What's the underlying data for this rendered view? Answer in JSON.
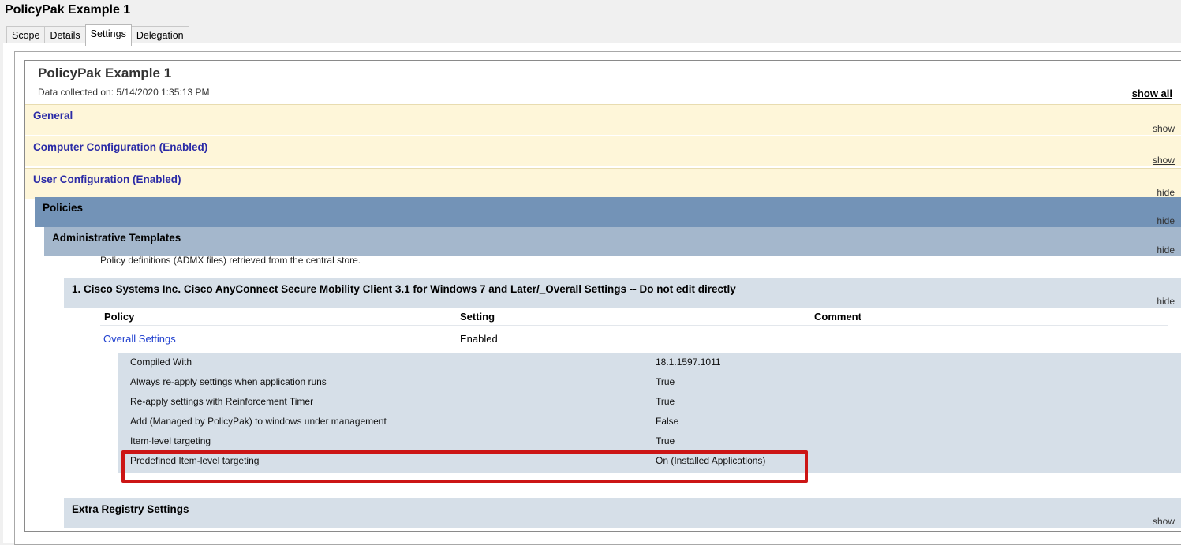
{
  "window": {
    "title": "PolicyPak Example 1"
  },
  "tabs": [
    {
      "label": "Scope"
    },
    {
      "label": "Details"
    },
    {
      "label": "Settings"
    },
    {
      "label": "Delegation"
    }
  ],
  "report": {
    "title": "PolicyPak Example 1",
    "collected": "Data collected on: 5/14/2020 1:35:13 PM",
    "show_all": "show all",
    "sections": {
      "general": {
        "label": "General",
        "action": "show"
      },
      "computer": {
        "label": "Computer Configuration (Enabled)",
        "action": "show"
      },
      "user": {
        "label": "User Configuration (Enabled)",
        "action": "hide"
      },
      "policies": {
        "label": "Policies",
        "action": "hide"
      },
      "admin": {
        "label": "Administrative Templates",
        "action": "hide"
      },
      "central_store": "Policy definitions (ADMX files) retrieved from the central store.",
      "cisco": {
        "label": "1. Cisco Systems Inc. Cisco AnyConnect Secure Mobility Client 3.1 for Windows 7 and Later/_Overall Settings -- Do not edit directly",
        "action": "hide"
      },
      "extra": {
        "label": "Extra Registry Settings",
        "action": "show"
      }
    },
    "policy_table": {
      "headers": [
        "Policy",
        "Setting",
        "Comment"
      ],
      "row": {
        "policy": "Overall Settings",
        "setting": "Enabled",
        "comment": ""
      }
    },
    "details": [
      {
        "key": "Compiled With",
        "value": "18.1.1597.1011"
      },
      {
        "key": "Always re-apply settings when application runs",
        "value": "True"
      },
      {
        "key": "Re-apply settings with Reinforcement Timer",
        "value": "True"
      },
      {
        "key": "Add (Managed by PolicyPak) to windows under management",
        "value": "False"
      },
      {
        "key": "Item-level targeting",
        "value": "True"
      },
      {
        "key": "Predefined Item-level targeting",
        "value": "On (Installed Applications)"
      }
    ]
  },
  "colors": {
    "highlight_box": "#cc1515",
    "section_yellow": "#fef6d9",
    "policies_band": "#7393b7",
    "admin_band": "#a4b7cc",
    "detail_band": "#d6dfe8"
  }
}
